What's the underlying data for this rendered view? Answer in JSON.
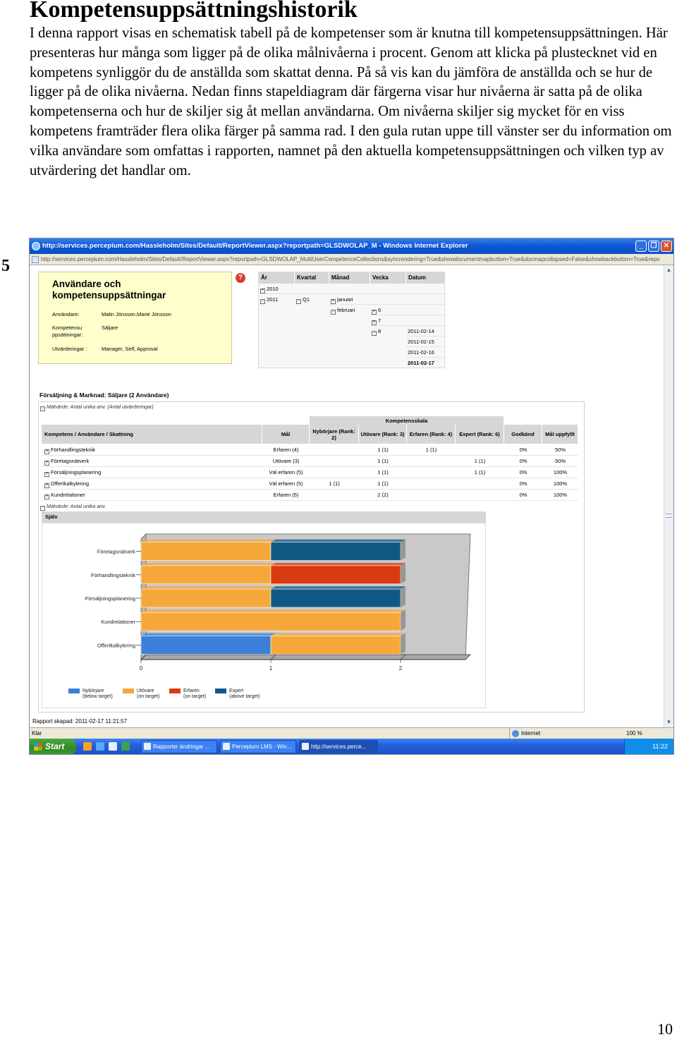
{
  "doc": {
    "title": "Kompetensuppsättningshistorik",
    "intro": "I denna rapport visas en schematisk tabell på de kompetenser som är knutna till kompetensuppsättningen. Här presenteras hur många som ligger på de olika målnivåerna i procent. Genom att klicka på plustecknet vid en kompetens synliggör du de anställda som skattat denna. På så vis kan du jämföra de anställda och se hur de ligger på de olika nivåerna. Nedan finns stapeldiagram där färgerna visar hur nivåerna är satta på de olika kompetenserna och hur de skiljer sig åt mellan användarna. Om nivåerna skiljer sig mycket för en viss kompetens framträder flera olika färger på samma rad. I den gula rutan uppe till vänster ser du information om vilka användare som omfattas i rapporten, namnet på den aktuella kompetensuppsättningen och vilken typ av utvärdering det handlar om.",
    "step": "5",
    "page_number": "10"
  },
  "browser": {
    "title": "http://services.percepium.com/Hassleholm/Sites/Default/ReportViewer.aspx?reportpath=GLSDWOLAP_M - Windows Internet Explorer",
    "address": "http://services.percepium.com/Hassleholm/Sites/Default/ReportViewer.aspx?reportpath=GLSDWOLAP_MultiUserCompetenceCollections&syncrendering=True&showdocumentmapbutton=True&docmapcollapsed=False&showbackbutton=True&repo",
    "status": "Klar",
    "zone": "Internet",
    "zoom": "100 %"
  },
  "infobox": {
    "title": "Användare och kompetensuppsättningar",
    "users_label": "Användare:",
    "users_value": "Malin Jönsson,Marie Jönsson",
    "set_label": "Kompetensu ppsättningar:",
    "set_value": "Säljare",
    "eval_label": "Utvärderingar :",
    "eval_value": "Manager, Self, Approval"
  },
  "datefilter": {
    "headers": [
      "År",
      "Kvartal",
      "Månad",
      "Vecka",
      "Datum"
    ],
    "year_2010": "2010",
    "year_2011": "2011",
    "quarter": "Q1",
    "month_jan": "januari",
    "month_feb": "februari",
    "week_6": "6",
    "week_7": "7",
    "week_8": "8",
    "dates": [
      "2011-02-14",
      "2011-02-15",
      "2011-02-16",
      "2011-02-17"
    ]
  },
  "report": {
    "title": "Försäljning & Marknad: Säljare (2 Användare)",
    "measure1": "Mätvärde: Antal unika anv. (Antal utvärderingar)",
    "measure2": "Mätvärde: Antal unika anv.",
    "scale_header": "Kompetensskala",
    "columns": {
      "competence": "Kompetens / Användare / Skattning",
      "goal": "Mål",
      "novice": "Nybörjare (Rank: 2)",
      "practitioner": "Utövare (Rank: 3)",
      "experienced": "Erfaren (Rank: 4)",
      "expert": "Expert (Rank: 6)",
      "approved": "Godkänd",
      "goal_met": "Mål uppfyllt"
    },
    "rows": [
      {
        "name": "Förhandlingsteknik",
        "goal": "Erfaren (4)",
        "novice": "",
        "practitioner": "1 (1)",
        "experienced": "1 (1)",
        "expert": "",
        "approved": "0%",
        "goal_met": "50%"
      },
      {
        "name": "Företagsnätverk",
        "goal": "Utövare (3)",
        "novice": "",
        "practitioner": "1 (1)",
        "experienced": "",
        "expert": "1 (1)",
        "approved": "0%",
        "goal_met": "50%"
      },
      {
        "name": "Försäljningsplanering",
        "goal": "Väl erfaren (5)",
        "novice": "",
        "practitioner": "1 (1)",
        "experienced": "",
        "expert": "1 (1)",
        "approved": "0%",
        "goal_met": "100%"
      },
      {
        "name": "Offertkalkylering",
        "goal": "Väl erfaren (5)",
        "novice": "1 (1)",
        "practitioner": "1 (1)",
        "experienced": "",
        "expert": "",
        "approved": "0%",
        "goal_met": "100%"
      },
      {
        "name": "Kundrelationer",
        "goal": "Erfaren (5)",
        "novice": "",
        "practitioner": "2 (2)",
        "experienced": "",
        "expert": "",
        "approved": "0%",
        "goal_met": "100%"
      }
    ],
    "section": "Själv",
    "created": "Rapport skapad: 2011-02-17 11:21:57"
  },
  "chart_data": {
    "type": "bar",
    "orientation": "horizontal",
    "stacked": true,
    "categories": [
      "Företagsnätverk",
      "Förhandlingsteknik",
      "Försäljningsplanering",
      "Kundrelationer",
      "Offertkalkylering"
    ],
    "series": [
      {
        "name": "Nybörjare",
        "subtitle": "(below target)",
        "color": "#3b7fd9",
        "values": [
          0,
          0,
          0,
          0,
          1
        ]
      },
      {
        "name": "Utövare",
        "subtitle": "(on target)",
        "color": "#f6a73a",
        "values": [
          1,
          1,
          1,
          2,
          1
        ]
      },
      {
        "name": "Erfaren",
        "subtitle": "(on target)",
        "color": "#d93a12",
        "values": [
          0,
          1,
          0,
          0,
          0
        ]
      },
      {
        "name": "Expert",
        "subtitle": "(above target)",
        "color": "#0f5a85",
        "values": [
          1,
          0,
          1,
          0,
          0
        ]
      }
    ],
    "xticks": [
      "0",
      "1",
      "2"
    ],
    "xlim": [
      0,
      2.5
    ],
    "legend": "bottom"
  },
  "taskbar": {
    "start": "Start",
    "tasks": [
      "Rapporter ändringar ...",
      "Percepium LMS - Win...",
      "http://services.perce..."
    ],
    "clock": "11:22"
  }
}
